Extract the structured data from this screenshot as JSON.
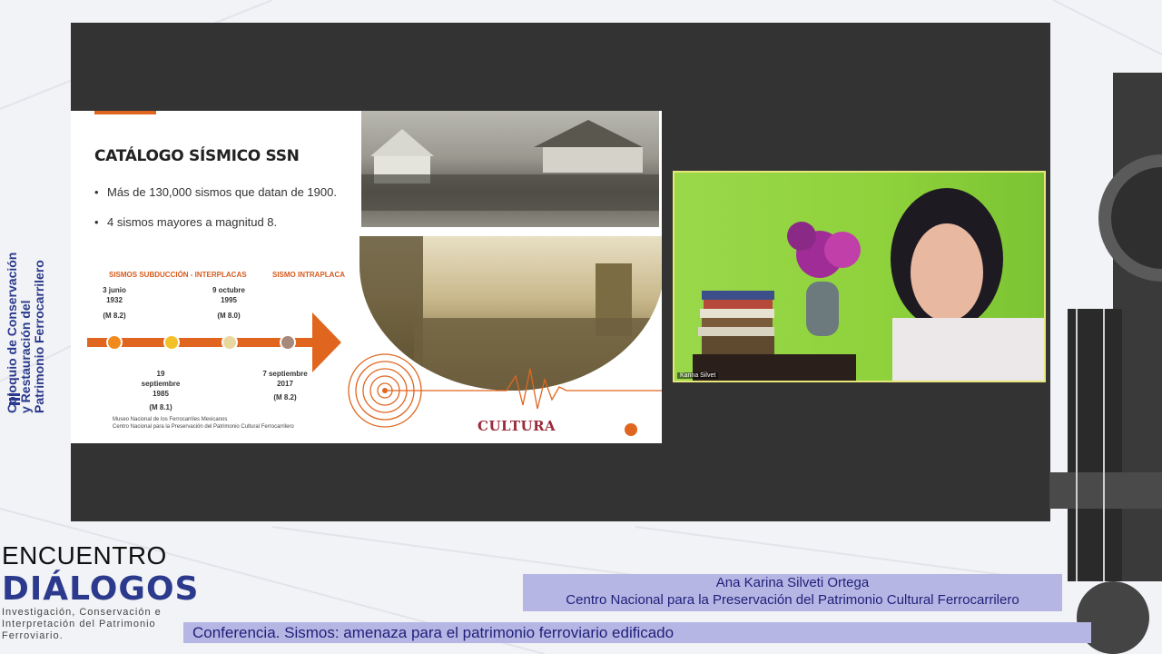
{
  "sidebar": {
    "title_line1": "Coloquio de Conservación",
    "title_line2": "y Restauración del",
    "title_line3": "Patrimonio Ferrocarrilero"
  },
  "slide": {
    "title": "CATÁLOGO SÍSMICO SSN",
    "bullets": [
      "Más de 130,000 sismos que datan de 1900.",
      "4 sismos mayores a magnitud 8."
    ],
    "timeline": {
      "label_subduccion": "SISMOS SUBDUCCIÓN - INTERPLACAS",
      "label_intraplaca": "SISMO INTRAPLACA",
      "events": [
        {
          "date": "3 junio 1932",
          "mag": "(M 8.2)",
          "color": "#f08a1c"
        },
        {
          "date": "19 septiembre 1985",
          "mag": "(M 8.1)",
          "color": "#f2c029"
        },
        {
          "date": "9 octubre 1995",
          "mag": "(M 8.0)",
          "color": "#e8d8a0"
        },
        {
          "date": "7 septiembre 2017",
          "mag": "(M 8.2)",
          "color": "#a6897a"
        }
      ]
    },
    "footer_museum_line1": "Museo Nacional de los Ferrocarriles Mexicanos",
    "footer_museum_line2": "Centro Nacional para la Preservación del Patrimonio Cultural Ferrocarrilero",
    "footer_brand": "CULTURA",
    "accent_color": "#e0661f"
  },
  "webcam": {
    "participant_name": "Karina Silvet"
  },
  "branding": {
    "encuentro": "ENCUENTRO",
    "dialogos": "DIÁLOGOS",
    "subtitle": "Investigación, Conservación e Interpretación del Patrimonio Ferroviario."
  },
  "lower_third": {
    "speaker_name": "Ana Karina Silveti Ortega",
    "speaker_org": "Centro Nacional para la Preservación del Patrimonio Cultural Ferrocarrilero",
    "talk_title": "Conferencia.  Sismos: amenaza para el patrimonio ferroviario edificado"
  }
}
